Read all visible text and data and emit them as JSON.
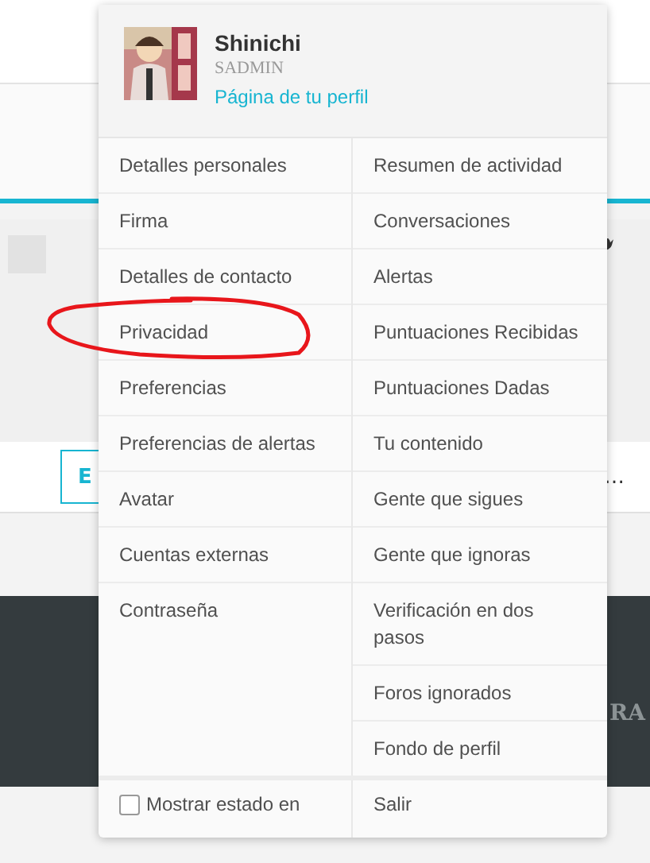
{
  "background": {
    "button": "E",
    "more": "…",
    "footer_text": "RA"
  },
  "menu": {
    "user": {
      "name": "Shinichi",
      "role": "SADMIN",
      "profile_link": "Página de tu perfil"
    },
    "left_items": [
      "Detalles personales",
      "Firma",
      "Detalles de contacto",
      "Privacidad",
      "Preferencias",
      "Preferencias de alertas",
      "Avatar",
      "Cuentas externas",
      "Contraseña"
    ],
    "right_items": [
      "Resumen de actividad",
      "Conversaciones",
      "Alertas",
      "Puntuaciones Recibidas",
      "Puntuaciones Dadas",
      "Tu contenido",
      "Gente que sigues",
      "Gente que ignoras",
      "Verificación en dos pasos",
      "Foros ignorados",
      "Fondo de perfil"
    ],
    "status_option": {
      "label": "Mostrar estado en",
      "checked": false
    },
    "logout": "Salir"
  }
}
